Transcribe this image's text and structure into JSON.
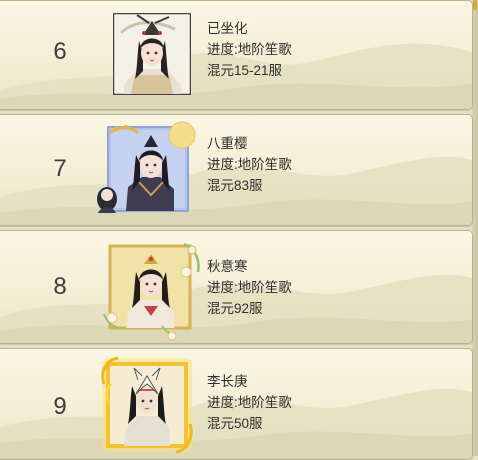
{
  "progress_prefix": "进度:",
  "realm_prefix": "混元",
  "rankings": [
    {
      "rank": "6",
      "name": "已坐化",
      "progress": "地阶笙歌",
      "realm_server": "15-21服",
      "frame": "plain"
    },
    {
      "rank": "7",
      "name": "八重樱",
      "progress": "地阶笙歌",
      "realm_server": "83服",
      "frame": "blue-moon"
    },
    {
      "rank": "8",
      "name": "秋意寒",
      "progress": "地阶笙歌",
      "realm_server": "92服",
      "frame": "gold-flower"
    },
    {
      "rank": "9",
      "name": "李长庚",
      "progress": "地阶笙歌",
      "realm_server": "50服",
      "frame": "golden-flame"
    }
  ],
  "colors": {
    "text": "#2f2f2f",
    "rank_text": "#3c3c3c",
    "card_bg": "#f6f1da",
    "card_border": "#b9b48f",
    "frame_gold": "#e0b84a",
    "frame_blue": "#8fa4d8"
  }
}
